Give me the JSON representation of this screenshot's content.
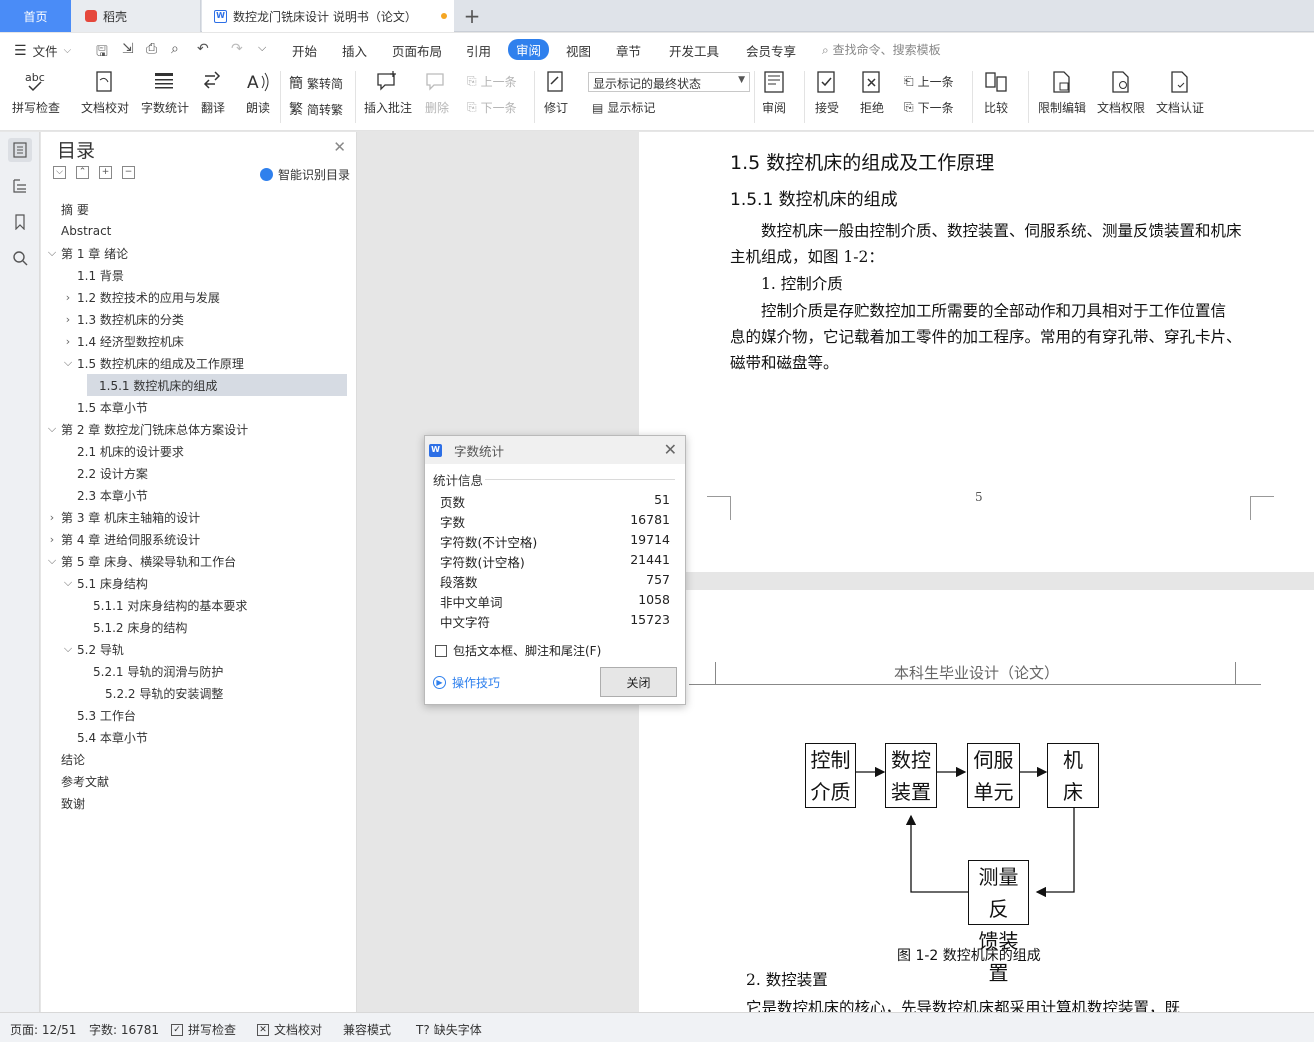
{
  "tabs": {
    "home": "首页",
    "daoke": "稻壳",
    "document": "数控龙门铣床设计 说明书（论文）",
    "add": "+"
  },
  "menu": {
    "file": "文件",
    "items": [
      "开始",
      "插入",
      "页面布局",
      "引用",
      "审阅",
      "视图",
      "章节",
      "开发工具",
      "会员专享"
    ],
    "active": "审阅",
    "search_placeholder": "查找命令、搜索模板"
  },
  "ribbon": {
    "spell_check": "拼写检查",
    "doc_proof": "文档校对",
    "word_count": "字数统计",
    "translate": "翻译",
    "read_aloud": "朗读",
    "trad_simp": "繁转简",
    "simp_trad": "简转繁",
    "insert_comment": "插入批注",
    "delete": "删除",
    "prev_comment": "上一条",
    "next_comment": "下一条",
    "revise": "修订",
    "markup_select": "显示标记的最终状态",
    "show_markup": "显示标记",
    "review": "审阅",
    "accept": "接受",
    "reject": "拒绝",
    "prev_change": "上一条",
    "next_change": "下一条",
    "compare": "比较",
    "restrict_edit": "限制编辑",
    "doc_permission": "文档权限",
    "doc_auth": "文档认证"
  },
  "toc": {
    "title": "目录",
    "smart": "智能识别目录",
    "items": [
      {
        "label": "摘  要",
        "level": 0,
        "arrow": ""
      },
      {
        "label": "Abstract",
        "level": 0,
        "arrow": ""
      },
      {
        "label": "第 1 章   绪论",
        "level": 0,
        "arrow": "v"
      },
      {
        "label": "1.1  背景",
        "level": 1,
        "arrow": ""
      },
      {
        "label": "1.2  数控技术的应用与发展",
        "level": 1,
        "arrow": ">"
      },
      {
        "label": "1.3  数控机床的分类",
        "level": 1,
        "arrow": ">"
      },
      {
        "label": "1.4  经济型数控机床",
        "level": 1,
        "arrow": ">"
      },
      {
        "label": "1.5  数控机床的组成及工作原理",
        "level": 1,
        "arrow": "v"
      },
      {
        "label": "1.5.1  数控机床的组成",
        "level": 2,
        "arrow": "",
        "selected": true
      },
      {
        "label": "1.5  本章小节",
        "level": 1,
        "arrow": ""
      },
      {
        "label": "第 2 章    数控龙门铣床总体方案设计",
        "level": 0,
        "arrow": "v"
      },
      {
        "label": "2.1  机床的设计要求",
        "level": 1,
        "arrow": ""
      },
      {
        "label": "2.2  设计方案",
        "level": 1,
        "arrow": ""
      },
      {
        "label": "2.3  本章小节",
        "level": 1,
        "arrow": ""
      },
      {
        "label": "第 3 章  机床主轴箱的设计",
        "level": 0,
        "arrow": ">"
      },
      {
        "label": "第 4 章  进给伺服系统设计",
        "level": 0,
        "arrow": ">"
      },
      {
        "label": "第 5 章  床身、横梁导轨和工作台",
        "level": 0,
        "arrow": "v"
      },
      {
        "label": "5.1  床身结构",
        "level": 1,
        "arrow": "v"
      },
      {
        "label": "5.1.1  对床身结构的基本要求",
        "level": 2,
        "arrow": ""
      },
      {
        "label": "5.1.2  床身的结构",
        "level": 2,
        "arrow": ""
      },
      {
        "label": "5.2  导轨",
        "level": 1,
        "arrow": "v"
      },
      {
        "label": "5.2.1  导轨的润滑与防护",
        "level": 2,
        "arrow": ""
      },
      {
        "label": "5.2.2  导轨的安装调整",
        "level": 3,
        "arrow": ""
      },
      {
        "label": "5.3  工作台",
        "level": 1,
        "arrow": ""
      },
      {
        "label": "5.4  本章小节",
        "level": 1,
        "arrow": ""
      },
      {
        "label": "结论",
        "level": 0,
        "arrow": ""
      },
      {
        "label": "参考文献",
        "level": 0,
        "arrow": ""
      },
      {
        "label": "致谢",
        "level": 0,
        "arrow": ""
      }
    ]
  },
  "doc": {
    "heading2": "1.5  数控机床的组成及工作原理",
    "heading3": "1.5.1  数控机床的组成",
    "para1_line1": "数控机床一般由控制介质、数控装置、伺服系统、测量反馈装置和机床",
    "para1_line2": "主机组成，如图 1-2：",
    "item1": "1. 控制介质",
    "para2_line1": "控制介质是存贮数控加工所需要的全部动作和刀具相对于工作位置信",
    "para2_line2": "息的媒介物，它记载着加工零件的加工程序。常用的有穿孔带、穿孔卡片、",
    "para2_line3": "磁带和磁盘等。",
    "page_number": "5",
    "page_header": "本科生毕业设计（论文）",
    "diagram": {
      "box1": [
        "控制",
        "介质"
      ],
      "box2": [
        "数控",
        "装置"
      ],
      "box3": [
        "伺服",
        "单元"
      ],
      "box4": [
        "机",
        "床"
      ],
      "box5": [
        "测量反",
        "馈装置"
      ]
    },
    "caption": "图 1-2 数控机床的组成",
    "item2": "2. 数控装置",
    "para3_partial": "它是数控机床的核心，先导数控机床都采用计算机数控装置，既"
  },
  "dialog": {
    "title": "字数统计",
    "group": "统计信息",
    "stats": [
      {
        "label": "页数",
        "value": "51"
      },
      {
        "label": "字数",
        "value": "16781"
      },
      {
        "label": "字符数(不计空格)",
        "value": "19714"
      },
      {
        "label": "字符数(计空格)",
        "value": "21441"
      },
      {
        "label": "段落数",
        "value": "757"
      },
      {
        "label": "非中文单词",
        "value": "1058"
      },
      {
        "label": "中文字符",
        "value": "15723"
      }
    ],
    "checkbox": "包括文本框、脚注和尾注(F)",
    "tips": "操作技巧",
    "close": "关闭"
  },
  "status": {
    "page": "页面: 12/51",
    "words": "字数: 16781",
    "spell": "拼写检查",
    "proof": "文档校对",
    "compat": "兼容模式",
    "missing_font": "缺失字体"
  }
}
